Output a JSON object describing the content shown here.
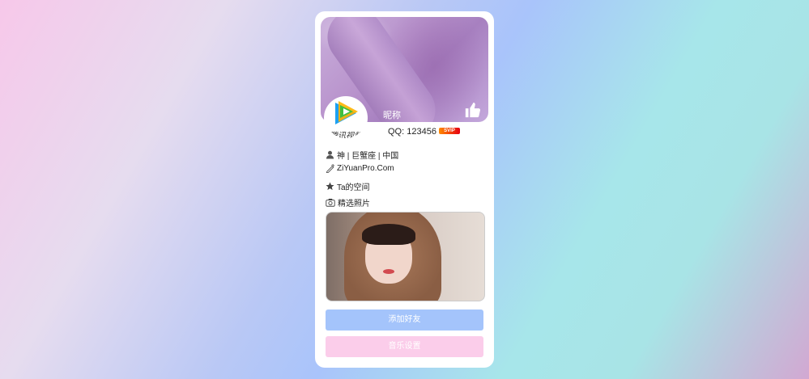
{
  "profile": {
    "nickname": "昵称",
    "avatar_text": "腾讯视频",
    "qq": "QQ: 123456",
    "vip_badge": "SVIP",
    "info": {
      "basic": "神 | 巨蟹座 | 中国",
      "website": "ZiYuanPro.Com",
      "space": "Ta的空间",
      "photos": "精选照片"
    }
  },
  "buttons": {
    "add_friend": "添加好友",
    "music_settings": "音乐设置"
  },
  "colors": {
    "add_button": "#a4c4fb",
    "music_button": "#fbcdea"
  },
  "icons": {
    "like": "thumbs-up-icon",
    "user": "user-icon",
    "link": "pen-link-icon",
    "star": "star-icon",
    "camera": "camera-icon"
  }
}
